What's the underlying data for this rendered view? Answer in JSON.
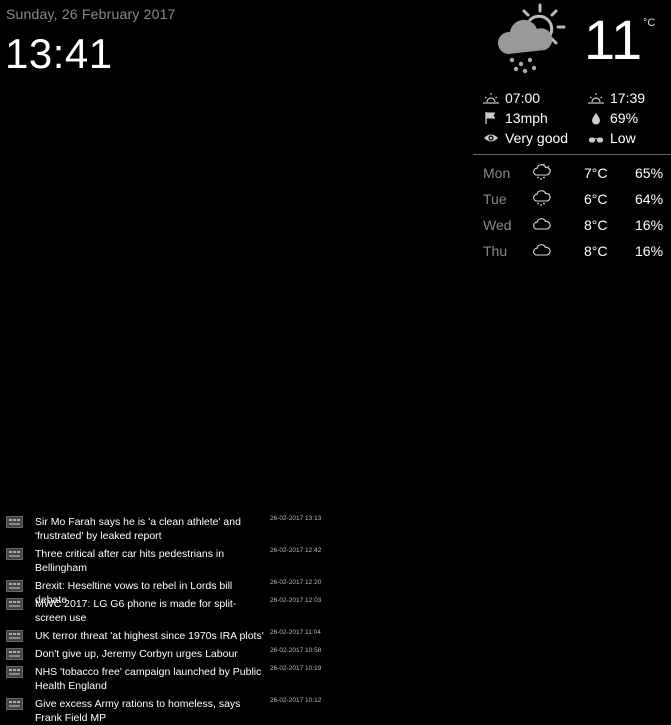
{
  "clock": {
    "date": "Sunday, 26 February 2017",
    "time": "13:41"
  },
  "weather": {
    "current_icon": "sun-cloud-rain-icon",
    "temperature": "11",
    "unit": "°C",
    "sunrise": "07:00",
    "sunset": "17:39",
    "wind": "13mph",
    "humidity": "69%",
    "visibility": "Very good",
    "uv": "Low"
  },
  "forecast": [
    {
      "day": "Mon",
      "icon": "sun-rain-icon",
      "temp": "7°C",
      "precip": "65%"
    },
    {
      "day": "Tue",
      "icon": "cloud-rain-icon",
      "temp": "6°C",
      "precip": "64%"
    },
    {
      "day": "Wed",
      "icon": "cloud-icon",
      "temp": "8°C",
      "precip": "16%"
    },
    {
      "day": "Thu",
      "icon": "cloud-icon",
      "temp": "8°C",
      "precip": "16%"
    }
  ],
  "news": [
    {
      "headline": "Sir Mo Farah says he is 'a clean athlete' and 'frustrated' by leaked report",
      "time": "26-02-2017 13:13"
    },
    {
      "headline": "Three critical after car hits pedestrians in Bellingham",
      "time": "26-02-2017 12:42"
    },
    {
      "headline": "Brexit: Heseltine vows to rebel in Lords bill debate",
      "time": "26-02-2017 12:20"
    },
    {
      "headline": "MWC 2017: LG G6 phone is made for split-screen use",
      "time": "26-02-2017 12:03"
    },
    {
      "headline": "UK terror threat 'at highest since 1970s IRA plots'",
      "time": "26-02-2017 11:04"
    },
    {
      "headline": "Don't give up, Jeremy Corbyn urges Labour",
      "time": "26-02-2017 10:58"
    },
    {
      "headline": "NHS 'tobacco free' campaign launched by Public Health England",
      "time": "26-02-2017 10:19"
    },
    {
      "headline": "Give excess Army rations to homeless, says Frank Field MP",
      "time": "26-02-2017 10:12"
    }
  ]
}
